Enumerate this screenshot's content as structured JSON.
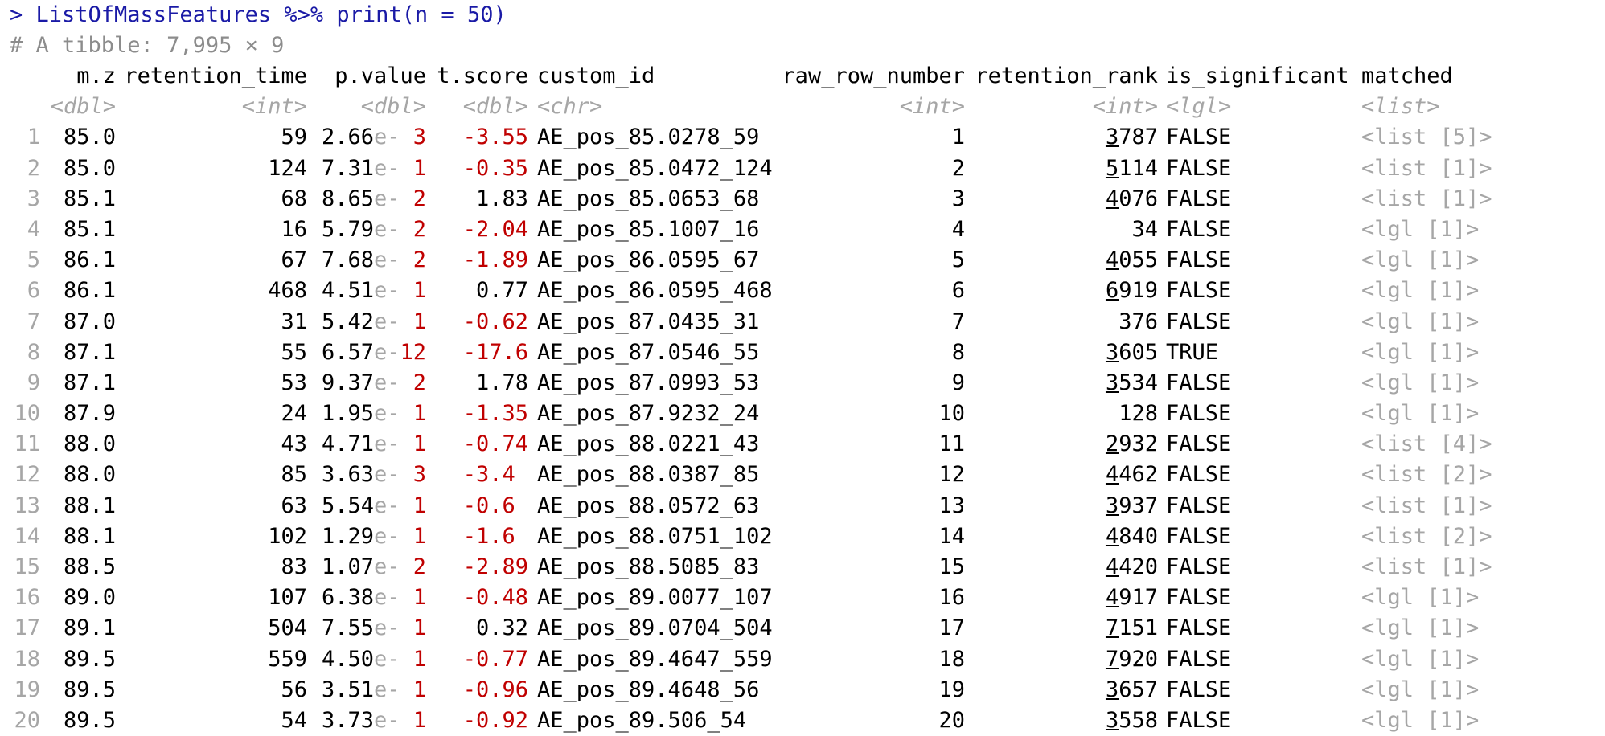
{
  "console": {
    "command": "> ListOfMassFeatures %>% print(n = 50)",
    "tibble_info": "# A tibble: 7,995 × 9"
  },
  "table": {
    "headers": [
      "m.z",
      "retention_time",
      "p.value",
      "t.score",
      "custom_id",
      "raw_row_number",
      "retention_rank",
      "is_significant",
      "matched"
    ],
    "types": [
      "<dbl>",
      "<int>",
      "<dbl>",
      "<dbl>",
      "<chr>",
      "<int>",
      "<int>",
      "<lgl>",
      "<list>"
    ],
    "rows": [
      {
        "idx": "1",
        "mz": "85.0",
        "rt": "59",
        "pv_mant": "2.66",
        "pv_e": "e-",
        "pv_exp": " 3",
        "ts": "-3.55",
        "cid": "AE_pos_85.0278_59",
        "rrn": "1",
        "rr_first": "3",
        "rr_rest": "787",
        "sig": "FALSE",
        "mat": "<list [5]>"
      },
      {
        "idx": "2",
        "mz": "85.0",
        "rt": "124",
        "pv_mant": "7.31",
        "pv_e": "e-",
        "pv_exp": " 1",
        "ts": "-0.35",
        "cid": "AE_pos_85.0472_124",
        "rrn": "2",
        "rr_first": "5",
        "rr_rest": "114",
        "sig": "FALSE",
        "mat": "<list [1]>"
      },
      {
        "idx": "3",
        "mz": "85.1",
        "rt": "68",
        "pv_mant": "8.65",
        "pv_e": "e-",
        "pv_exp": " 2",
        "ts": "1.83",
        "cid": "AE_pos_85.0653_68",
        "rrn": "3",
        "rr_first": "4",
        "rr_rest": "076",
        "sig": "FALSE",
        "mat": "<list [1]>"
      },
      {
        "idx": "4",
        "mz": "85.1",
        "rt": "16",
        "pv_mant": "5.79",
        "pv_e": "e-",
        "pv_exp": " 2",
        "ts": "-2.04",
        "cid": "AE_pos_85.1007_16",
        "rrn": "4",
        "rr_first": "",
        "rr_rest": "34",
        "sig": "FALSE",
        "mat": "<lgl [1]>"
      },
      {
        "idx": "5",
        "mz": "86.1",
        "rt": "67",
        "pv_mant": "7.68",
        "pv_e": "e-",
        "pv_exp": " 2",
        "ts": "-1.89",
        "cid": "AE_pos_86.0595_67",
        "rrn": "5",
        "rr_first": "4",
        "rr_rest": "055",
        "sig": "FALSE",
        "mat": "<lgl [1]>"
      },
      {
        "idx": "6",
        "mz": "86.1",
        "rt": "468",
        "pv_mant": "4.51",
        "pv_e": "e-",
        "pv_exp": " 1",
        "ts": "0.77",
        "cid": "AE_pos_86.0595_468",
        "rrn": "6",
        "rr_first": "6",
        "rr_rest": "919",
        "sig": "FALSE",
        "mat": "<lgl [1]>"
      },
      {
        "idx": "7",
        "mz": "87.0",
        "rt": "31",
        "pv_mant": "5.42",
        "pv_e": "e-",
        "pv_exp": " 1",
        "ts": "-0.62",
        "cid": "AE_pos_87.0435_31",
        "rrn": "7",
        "rr_first": "",
        "rr_rest": "376",
        "sig": "FALSE",
        "mat": "<lgl [1]>"
      },
      {
        "idx": "8",
        "mz": "87.1",
        "rt": "55",
        "pv_mant": "6.57",
        "pv_e": "e-",
        "pv_exp": "12",
        "ts": "-17.6",
        "cid": "AE_pos_87.0546_55",
        "rrn": "8",
        "rr_first": "3",
        "rr_rest": "605",
        "sig": "TRUE",
        "mat": "<lgl [1]>"
      },
      {
        "idx": "9",
        "mz": "87.1",
        "rt": "53",
        "pv_mant": "9.37",
        "pv_e": "e-",
        "pv_exp": " 2",
        "ts": "1.78",
        "cid": "AE_pos_87.0993_53",
        "rrn": "9",
        "rr_first": "3",
        "rr_rest": "534",
        "sig": "FALSE",
        "mat": "<lgl [1]>"
      },
      {
        "idx": "10",
        "mz": "87.9",
        "rt": "24",
        "pv_mant": "1.95",
        "pv_e": "e-",
        "pv_exp": " 1",
        "ts": "-1.35",
        "cid": "AE_pos_87.9232_24",
        "rrn": "10",
        "rr_first": "",
        "rr_rest": "128",
        "sig": "FALSE",
        "mat": "<lgl [1]>"
      },
      {
        "idx": "11",
        "mz": "88.0",
        "rt": "43",
        "pv_mant": "4.71",
        "pv_e": "e-",
        "pv_exp": " 1",
        "ts": "-0.74",
        "cid": "AE_pos_88.0221_43",
        "rrn": "11",
        "rr_first": "2",
        "rr_rest": "932",
        "sig": "FALSE",
        "mat": "<list [4]>"
      },
      {
        "idx": "12",
        "mz": "88.0",
        "rt": "85",
        "pv_mant": "3.63",
        "pv_e": "e-",
        "pv_exp": " 3",
        "ts": "-3.4 ",
        "cid": "AE_pos_88.0387_85",
        "rrn": "12",
        "rr_first": "4",
        "rr_rest": "462",
        "sig": "FALSE",
        "mat": "<list [2]>"
      },
      {
        "idx": "13",
        "mz": "88.1",
        "rt": "63",
        "pv_mant": "5.54",
        "pv_e": "e-",
        "pv_exp": " 1",
        "ts": "-0.6 ",
        "cid": "AE_pos_88.0572_63",
        "rrn": "13",
        "rr_first": "3",
        "rr_rest": "937",
        "sig": "FALSE",
        "mat": "<list [1]>"
      },
      {
        "idx": "14",
        "mz": "88.1",
        "rt": "102",
        "pv_mant": "1.29",
        "pv_e": "e-",
        "pv_exp": " 1",
        "ts": "-1.6 ",
        "cid": "AE_pos_88.0751_102",
        "rrn": "14",
        "rr_first": "4",
        "rr_rest": "840",
        "sig": "FALSE",
        "mat": "<list [2]>"
      },
      {
        "idx": "15",
        "mz": "88.5",
        "rt": "83",
        "pv_mant": "1.07",
        "pv_e": "e-",
        "pv_exp": " 2",
        "ts": "-2.89",
        "cid": "AE_pos_88.5085_83",
        "rrn": "15",
        "rr_first": "4",
        "rr_rest": "420",
        "sig": "FALSE",
        "mat": "<list [1]>"
      },
      {
        "idx": "16",
        "mz": "89.0",
        "rt": "107",
        "pv_mant": "6.38",
        "pv_e": "e-",
        "pv_exp": " 1",
        "ts": "-0.48",
        "cid": "AE_pos_89.0077_107",
        "rrn": "16",
        "rr_first": "4",
        "rr_rest": "917",
        "sig": "FALSE",
        "mat": "<lgl [1]>"
      },
      {
        "idx": "17",
        "mz": "89.1",
        "rt": "504",
        "pv_mant": "7.55",
        "pv_e": "e-",
        "pv_exp": " 1",
        "ts": "0.32",
        "cid": "AE_pos_89.0704_504",
        "rrn": "17",
        "rr_first": "7",
        "rr_rest": "151",
        "sig": "FALSE",
        "mat": "<lgl [1]>"
      },
      {
        "idx": "18",
        "mz": "89.5",
        "rt": "559",
        "pv_mant": "4.50",
        "pv_e": "e-",
        "pv_exp": " 1",
        "ts": "-0.77",
        "cid": "AE_pos_89.4647_559",
        "rrn": "18",
        "rr_first": "7",
        "rr_rest": "920",
        "sig": "FALSE",
        "mat": "<lgl [1]>"
      },
      {
        "idx": "19",
        "mz": "89.5",
        "rt": "56",
        "pv_mant": "3.51",
        "pv_e": "e-",
        "pv_exp": " 1",
        "ts": "-0.96",
        "cid": "AE_pos_89.4648_56",
        "rrn": "19",
        "rr_first": "3",
        "rr_rest": "657",
        "sig": "FALSE",
        "mat": "<lgl [1]>"
      },
      {
        "idx": "20",
        "mz": "89.5",
        "rt": "54",
        "pv_mant": "3.73",
        "pv_e": "e-",
        "pv_exp": " 1",
        "ts": "-0.92",
        "cid": "AE_pos_89.506_54",
        "rrn": "20",
        "rr_first": "3",
        "rr_rest": "558",
        "sig": "FALSE",
        "mat": "<lgl [1]>"
      }
    ]
  },
  "colors": {
    "command": "#1a1aa6",
    "comment": "#8c8c8c",
    "negative": "#c00000",
    "muted": "#a6a6a6",
    "text": "#000000",
    "background": "#ffffff"
  }
}
